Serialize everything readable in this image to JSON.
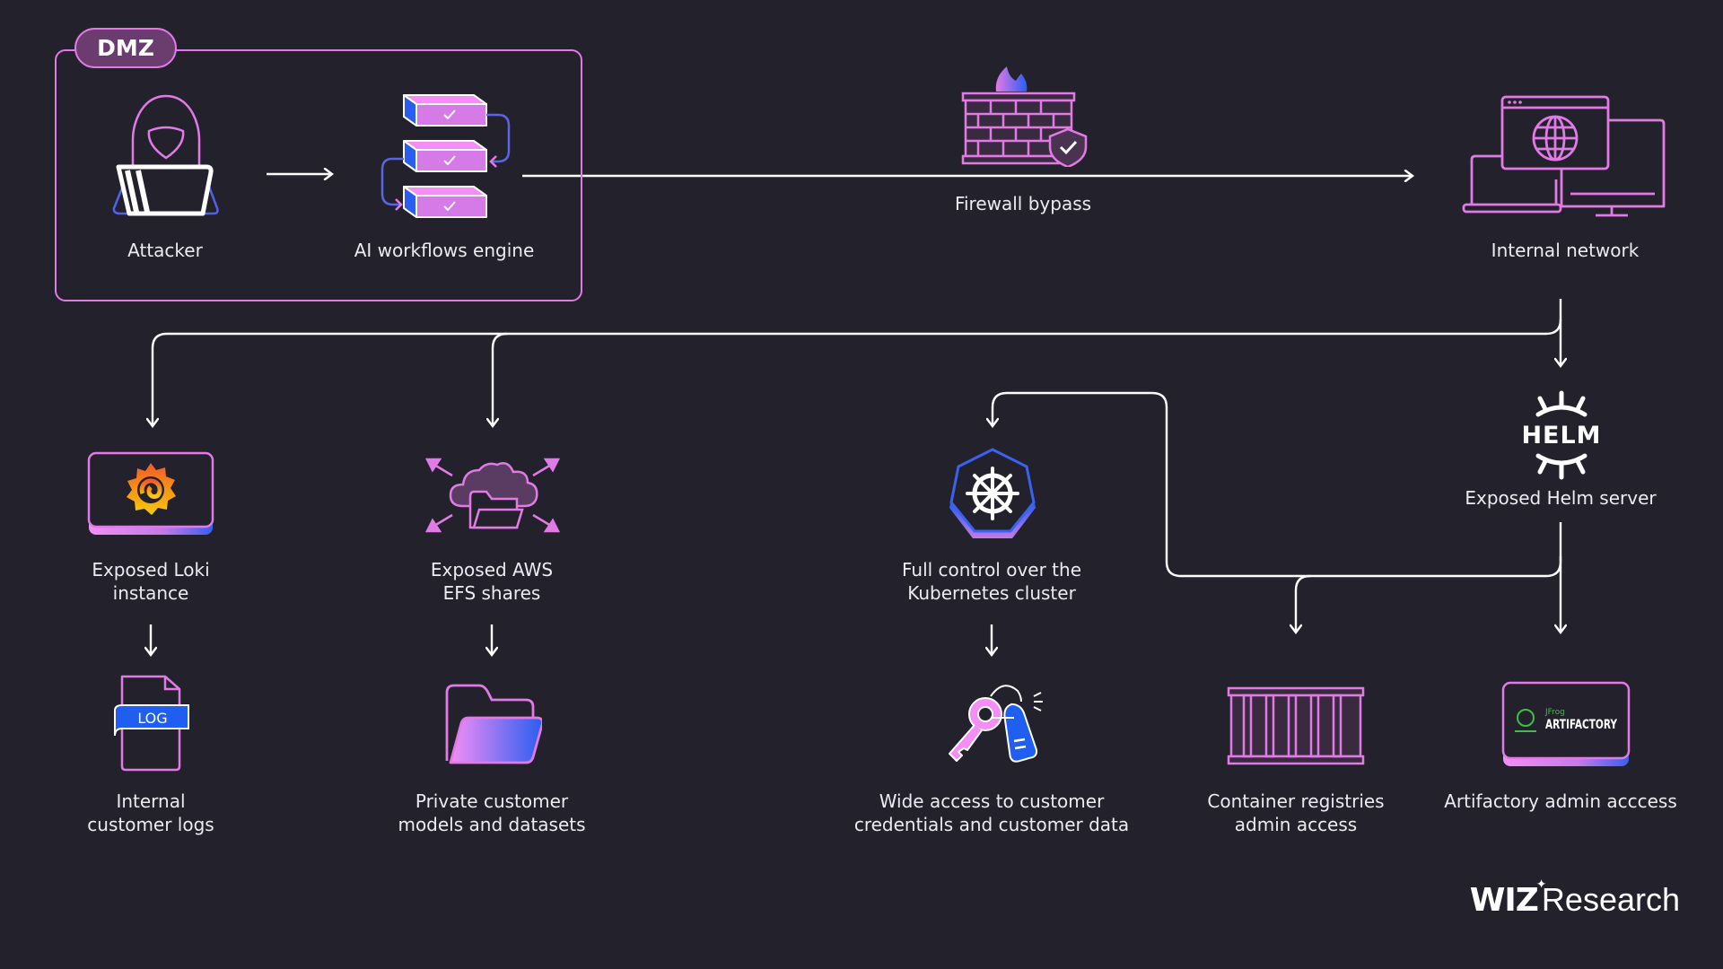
{
  "zone": {
    "label": "DMZ"
  },
  "nodes": {
    "attacker": "Attacker",
    "ai_engine": "AI workflows engine",
    "firewall": "Firewall bypass",
    "internal_network": "Internal network",
    "loki_line1": "Exposed Loki",
    "loki_line2": "instance",
    "efs_line1": "Exposed AWS",
    "efs_line2": "EFS shares",
    "k8s_line1": "Full control over the",
    "k8s_line2": "Kubernetes cluster",
    "helm": "Exposed Helm server",
    "logs_line1": "Internal",
    "logs_line2": "customer logs",
    "models_line1": "Private customer",
    "models_line2": "models and datasets",
    "creds_line1": "Wide access to customer",
    "creds_line2": "credentials and customer data",
    "registries_line1": "Container registries",
    "registries_line2": "admin access",
    "artifactory": "Artifactory admin acccess"
  },
  "icons": {
    "log_badge": "LOG",
    "helm_word": "HELM",
    "jfrog_small": "JFrog",
    "artifactory_word": "ARTIFACTORY"
  },
  "brand": {
    "wiz": "WIZ",
    "research": "Research"
  },
  "colors": {
    "accent": "#e27ae6",
    "blue": "#2a5ef0",
    "background": "#23222c",
    "wire": "#ffffff"
  }
}
